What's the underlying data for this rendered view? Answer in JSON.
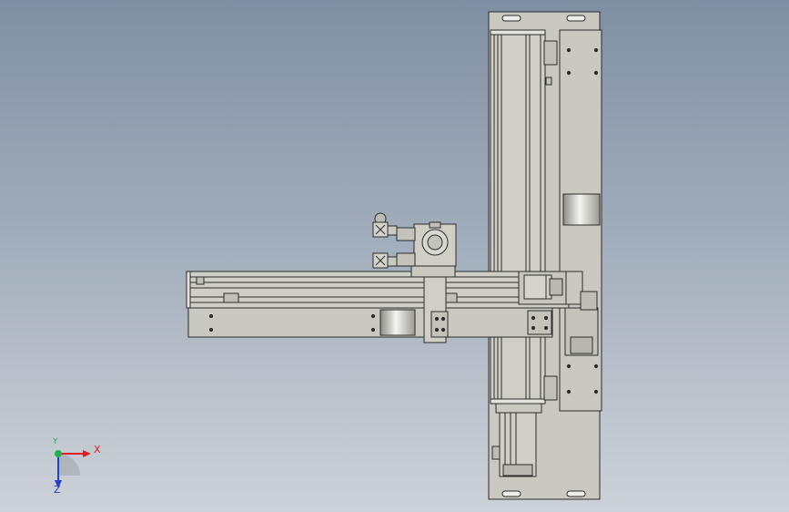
{
  "viewport": {
    "background_top": "#7f8fa3",
    "background_bottom": "#cdd2d8"
  },
  "model": {
    "part_fill": "#c9c9c1",
    "part_fill_dark": "#b4b4ac",
    "edge_color": "#2b2b2b",
    "highlight": "#efefef"
  },
  "triad": {
    "x_label": "X",
    "y_label": "Y",
    "z_label": "Z",
    "x_color": "#e02020",
    "y_color": "#22b14c",
    "z_color": "#2040d0"
  }
}
